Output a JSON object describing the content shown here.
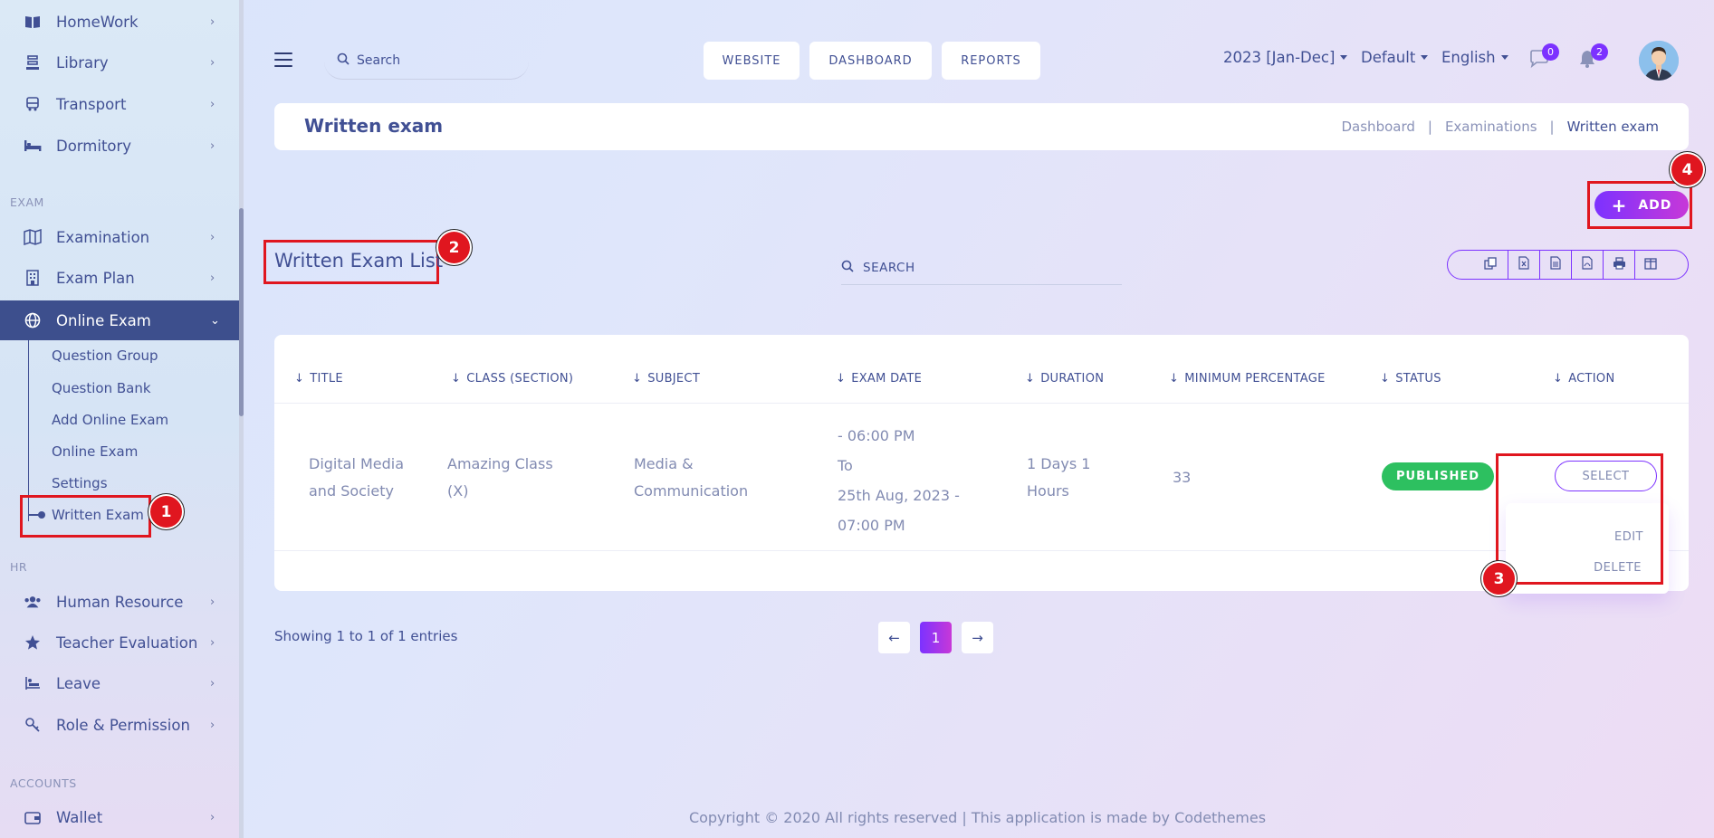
{
  "sidebar": {
    "items_top": [
      {
        "label": "HomeWork",
        "icon": "book-icon"
      },
      {
        "label": "Library",
        "icon": "library-icon"
      },
      {
        "label": "Transport",
        "icon": "bus-icon"
      },
      {
        "label": "Dormitory",
        "icon": "bed-icon"
      }
    ],
    "section_exam": "EXAM",
    "items_exam": [
      {
        "label": "Examination",
        "icon": "map-icon"
      },
      {
        "label": "Exam Plan",
        "icon": "building-icon"
      },
      {
        "label": "Online Exam",
        "icon": "globe-icon"
      }
    ],
    "online_exam_sub": [
      "Question Group",
      "Question Bank",
      "Add Online Exam",
      "Online Exam",
      "Settings",
      "Written Exam"
    ],
    "section_hr": "HR",
    "items_hr": [
      {
        "label": "Human Resource",
        "icon": "users-icon"
      },
      {
        "label": "Teacher Evaluation",
        "icon": "star-icon"
      },
      {
        "label": "Leave",
        "icon": "leave-icon"
      },
      {
        "label": "Role & Permission",
        "icon": "key-icon"
      }
    ],
    "section_accounts": "ACCOUNTS",
    "items_accounts": [
      {
        "label": "Wallet",
        "icon": "wallet-icon"
      }
    ]
  },
  "topbar": {
    "search_placeholder": "Search",
    "buttons": [
      "WEBSITE",
      "DASHBOARD",
      "REPORTS"
    ],
    "session": "2023 [Jan-Dec]",
    "style": "Default",
    "language": "English",
    "messages_count": "0",
    "notifications_count": "2"
  },
  "header": {
    "title": "Written exam",
    "breadcrumbs": [
      "Dashboard",
      "Examinations",
      "Written exam"
    ],
    "separator": "|"
  },
  "add_label": "ADD",
  "list": {
    "title": "Written Exam List",
    "search_placeholder": "SEARCH",
    "tools": [
      "copy-icon",
      "excel-icon",
      "csv-icon",
      "pdf-icon",
      "print-icon",
      "columns-icon"
    ],
    "columns": [
      "TITLE",
      "CLASS (SECTION)",
      "SUBJECT",
      "EXAM DATE",
      "DURATION",
      "MINIMUM PERCENTAGE",
      "STATUS",
      "ACTION"
    ],
    "rows": [
      {
        "title": [
          "Digital Media",
          "and Society"
        ],
        "class": [
          "Amazing Class",
          "(X)"
        ],
        "subject": [
          "Media &",
          "Communication"
        ],
        "exam_date": [
          "- 06:00 PM",
          "To",
          "25th Aug, 2023 -",
          "07:00 PM"
        ],
        "duration": [
          "1 Days 1",
          "Hours"
        ],
        "min_percentage": "33",
        "status": "PUBLISHED",
        "action": "SELECT"
      }
    ],
    "action_menu": [
      "EDIT",
      "DELETE"
    ]
  },
  "pagination": {
    "showing": "Showing 1 to 1 of 1 entries",
    "current": "1",
    "prev": "←",
    "next": "→"
  },
  "annotations": [
    "1",
    "2",
    "3",
    "4"
  ],
  "footer": "Copyright © 2020 All rights reserved | This application is made by Codethemes",
  "colors": {
    "primary": "#415094",
    "accent_purple": "#7c32ff",
    "accent_pink": "#c738d8",
    "published_green": "#2dc060",
    "annotation_red": "#e0161f",
    "sidebar_active": "#3d4f8d"
  }
}
